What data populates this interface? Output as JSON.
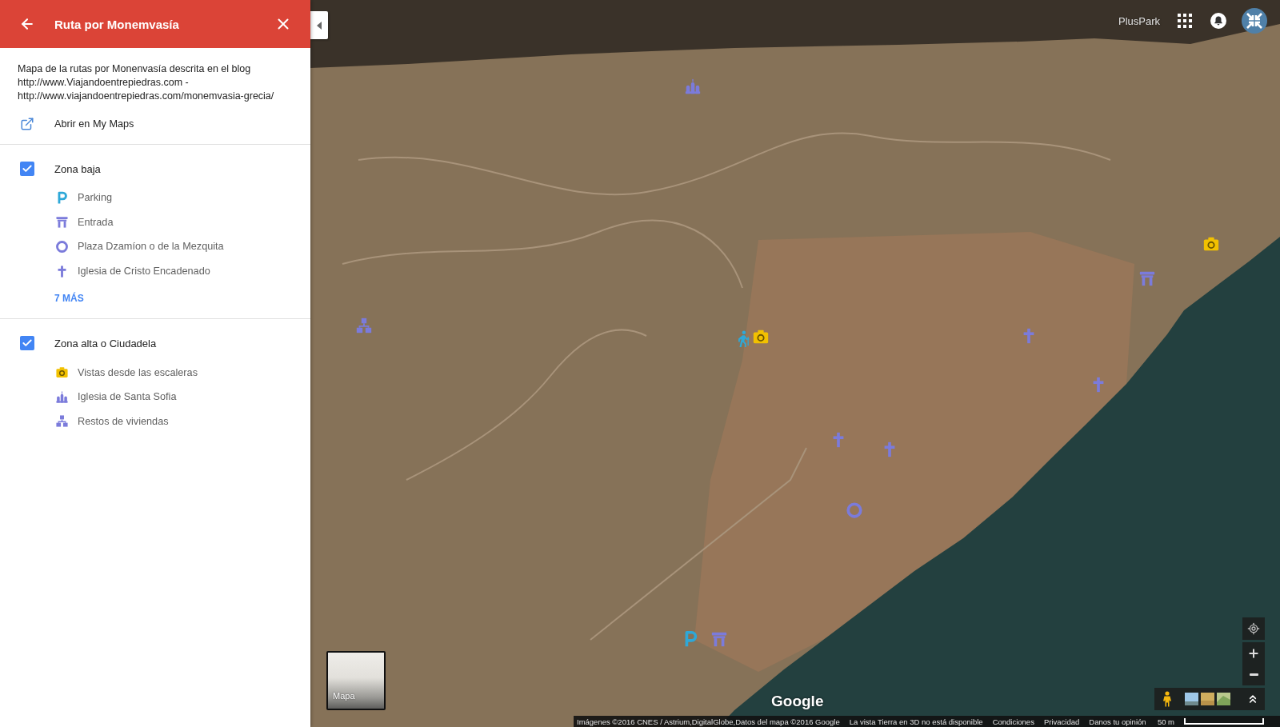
{
  "panel": {
    "title": "Ruta por Monemvasía",
    "description": "Mapa de la rutas por Monenvasía descrita en el blog http://www.Viajandoentrepiedras.com - http://www.viajandoentrepiedras.com/monemvasia-grecia/",
    "open_link": "Abrir en My Maps"
  },
  "layers": [
    {
      "name": "Zona baja",
      "checked": true,
      "items": [
        {
          "label": "Parking",
          "kind": "parking",
          "color": "#2ea8d8"
        },
        {
          "label": "Entrada",
          "kind": "gate",
          "color": "#7b7bdb"
        },
        {
          "label": "Plaza Dzamíon o de la Mezquita",
          "kind": "ring",
          "color": "#7b7bdb"
        },
        {
          "label": "Iglesia de Cristo Encadenado",
          "kind": "cross",
          "color": "#7b7bdb"
        }
      ],
      "more": "7 MÁS"
    },
    {
      "name": "Zona alta o Ciudadela",
      "checked": true,
      "items": [
        {
          "label": "Vistas desde las escaleras",
          "kind": "camera",
          "color": "#f2c100"
        },
        {
          "label": "Iglesia de Santa Sofia",
          "kind": "church",
          "color": "#7b7bdb"
        },
        {
          "label": "Restos de viviendas",
          "kind": "blocks",
          "color": "#7b7bdb"
        }
      ]
    }
  ],
  "account": {
    "name": "PlusPark"
  },
  "map": {
    "markers": [
      {
        "kind": "church",
        "color": "#7b7bdb"
      },
      {
        "kind": "blocks",
        "color": "#7b7bdb"
      },
      {
        "kind": "hiker",
        "color": "#2ea8d8"
      },
      {
        "kind": "camera",
        "color": "#f2c100"
      },
      {
        "kind": "camera",
        "color": "#f2c100"
      },
      {
        "kind": "gate",
        "color": "#7b7bdb"
      },
      {
        "kind": "cross",
        "color": "#7b7bdb"
      },
      {
        "kind": "cross",
        "color": "#7b7bdb"
      },
      {
        "kind": "cross",
        "color": "#7b7bdb"
      },
      {
        "kind": "cross",
        "color": "#7b7bdb"
      },
      {
        "kind": "ring",
        "color": "#7b7bdb"
      },
      {
        "kind": "parking",
        "color": "#2ea8d8"
      },
      {
        "kind": "gate",
        "color": "#7b7bdb"
      }
    ],
    "map_type": "Mapa",
    "logo": "Google",
    "attribution": "Imágenes ©2016 CNES / Astrium,DigitalGlobe,Datos del mapa ©2016 Google",
    "notice": "La vista Tierra en 3D no está disponible",
    "links": [
      "Condiciones",
      "Privacidad",
      "Danos tu opinión"
    ],
    "scale": "50 m"
  }
}
